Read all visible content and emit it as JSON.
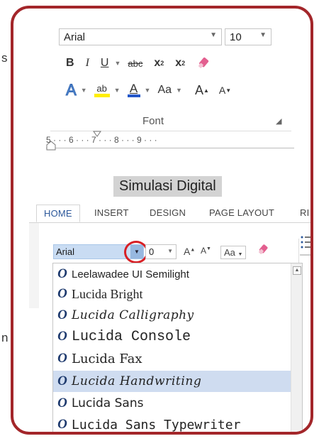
{
  "edge_text": {
    "left": "s",
    "right": "n"
  },
  "font_group": {
    "font_name": "Arial",
    "font_size": "10",
    "buttons": {
      "bold": "B",
      "italic": "I",
      "underline": "U",
      "strikethrough": "abc",
      "subscript": "x",
      "subscript_mark": "2",
      "superscript": "x",
      "superscript_mark": "2",
      "text_effects": "A",
      "highlight": "ab",
      "font_color": "A",
      "change_case": "Aa",
      "grow_font": "A",
      "shrink_font": "A"
    },
    "group_label": "Font",
    "ruler_ticks": "5 · · · 6 · · · 7 · · · 8 · · · 9 · · ·"
  },
  "caption": "Simulasi Digital",
  "ribbon": {
    "tabs": [
      "HOME",
      "INSERT",
      "DESIGN",
      "PAGE LAYOUT",
      "RI"
    ],
    "active_tab": "HOME",
    "font_name": "Arial",
    "font_size": "0",
    "grow_font": "A",
    "shrink_font": "A",
    "change_case": "Aa"
  },
  "font_list": [
    {
      "name": "Leelawadee UI Semilight",
      "highlighted": false
    },
    {
      "name": "Lucida Bright",
      "highlighted": false
    },
    {
      "name": "Lucida Calligraphy",
      "highlighted": false
    },
    {
      "name": "Lucida Console",
      "highlighted": false
    },
    {
      "name": "Lucida Fax",
      "highlighted": false
    },
    {
      "name": "Lucida Handwriting",
      "highlighted": true
    },
    {
      "name": "Lucida Sans",
      "highlighted": false
    },
    {
      "name": "Lucida Sans Typewriter",
      "highlighted": false
    }
  ],
  "colors": {
    "frame_border": "#a3262a",
    "selection_highlight": "#cfdcf0",
    "annotation_circle": "#d71f25",
    "accent_tab": "#2b579a"
  }
}
